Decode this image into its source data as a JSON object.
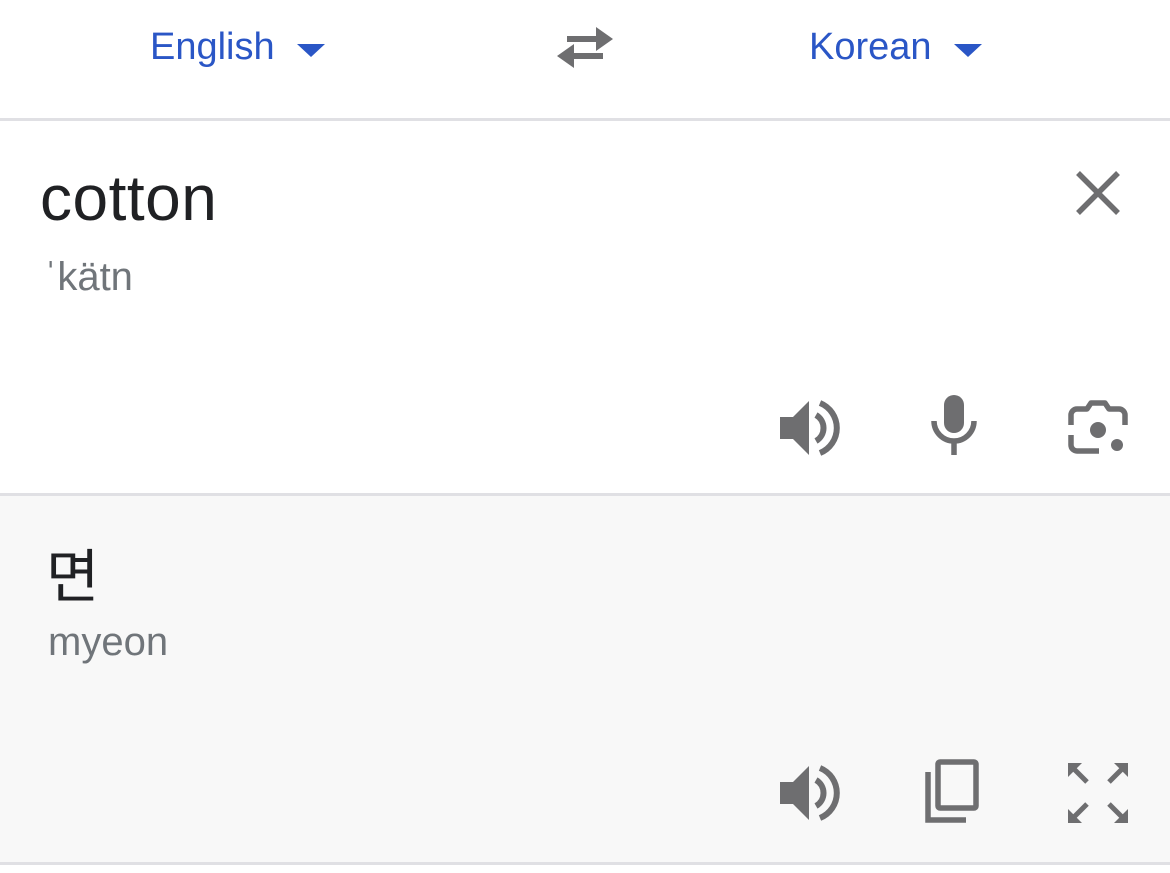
{
  "language_bar": {
    "source_language": "English",
    "target_language": "Korean",
    "swap_icon": "swap-arrows-icon",
    "dropdown_icon": "caret-down-icon"
  },
  "source": {
    "text": "cotton",
    "phonetic": "ˈkätn",
    "icons": [
      "close-icon",
      "speaker-icon",
      "microphone-icon",
      "camera-lens-icon"
    ]
  },
  "translation": {
    "text": "면",
    "romanization": "myeon",
    "icons": [
      "speaker-icon",
      "copy-icon",
      "fullscreen-icon"
    ]
  },
  "colors": {
    "accent": "#2a56c6",
    "icon": "#6e6e70",
    "divider": "#e0e0e4",
    "translation_background": "#f8f8f8"
  }
}
